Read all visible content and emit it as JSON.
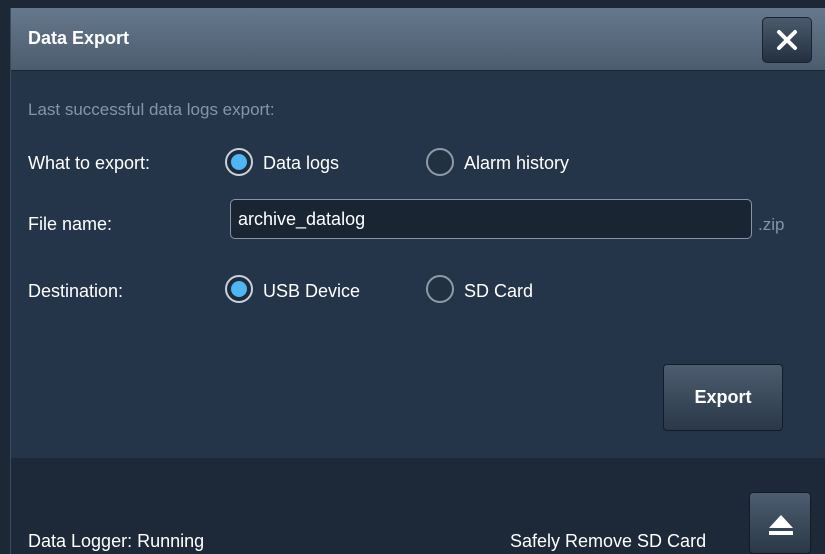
{
  "dialog": {
    "title": "Data Export",
    "close_icon": "close-icon"
  },
  "form": {
    "last_export_label": "Last successful data logs export:",
    "what_label": "What to export:",
    "what_options": [
      {
        "label": "Data logs",
        "selected": true
      },
      {
        "label": "Alarm history",
        "selected": false
      }
    ],
    "file_label": "File name:",
    "file_value": "archive_datalog",
    "file_ext": ".zip",
    "dest_label": "Destination:",
    "dest_options": [
      {
        "label": "USB Device",
        "selected": true
      },
      {
        "label": "SD Card",
        "selected": false
      }
    ],
    "export_label": "Export"
  },
  "footer": {
    "logger_status": "Data Logger:  Running",
    "remove_sd_label": "Safely Remove SD Card",
    "eject_icon": "eject-icon"
  },
  "colors": {
    "accent": "#4fb6f3",
    "background": "#243447",
    "titlebar": "#56687b"
  }
}
